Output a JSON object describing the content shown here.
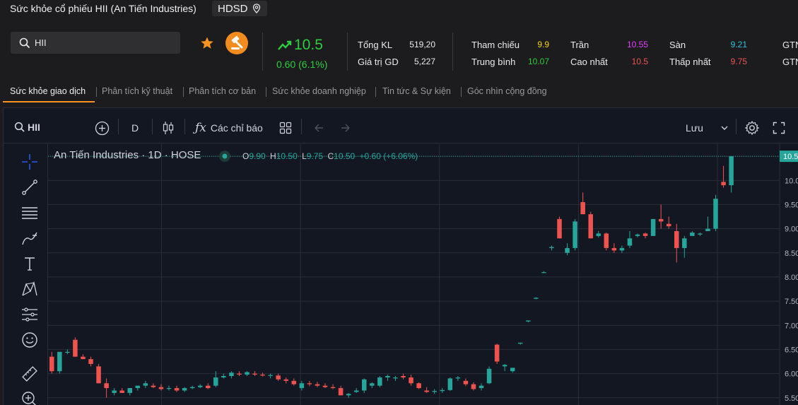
{
  "header": {
    "title": "Sức khỏe cổ phiếu HII (An Tiến Industries)",
    "hdsd_label": "HDSD"
  },
  "search": {
    "value": "HII"
  },
  "quote": {
    "price": "10.5",
    "change": "0.60 (6.1%)",
    "up_color": "#2ecc40"
  },
  "stats": [
    {
      "label": "Tổng KL",
      "value": "519,20",
      "color": "#eaeaea"
    },
    {
      "label": "Giá trị GD",
      "value": "5,227",
      "color": "#eaeaea"
    },
    {
      "label": "Tham chiếu",
      "value": "9.9",
      "color": "#f5d300"
    },
    {
      "label": "Trung bình",
      "value": "10.07",
      "color": "#2ecc40"
    },
    {
      "label": "Trần",
      "value": "10.55",
      "color": "#e040fb"
    },
    {
      "label": "Cao nhất",
      "value": "10.5",
      "color": "#ef5350"
    },
    {
      "label": "Sàn",
      "value": "9.21",
      "color": "#26c6da"
    },
    {
      "label": "Thấp nhất",
      "value": "9.75",
      "color": "#ef5350"
    },
    {
      "label": "GTN",
      "value": "",
      "color": "#eaeaea"
    },
    {
      "label": "GTN",
      "value": "",
      "color": "#eaeaea"
    }
  ],
  "tabs": [
    "Sức khỏe giao dịch",
    "Phân tích kỹ thuật",
    "Phân tích cơ bản",
    "Sức khỏe doanh nghiệp",
    "Tin tức & Sự kiện",
    "Góc nhìn cộng đồng"
  ],
  "chart_toolbar": {
    "symbol": "HII",
    "interval": "D",
    "indicators_label": "Các chỉ báo",
    "save_label": "Lưu"
  },
  "legend": {
    "name": "An Tiến Industries · 1D · HOSE",
    "o_label": "O",
    "o_value": "9.90",
    "h_label": "H",
    "h_value": "10.50",
    "l_label": "L",
    "l_value": "9.75",
    "c_label": "C",
    "c_value": "10.50",
    "change": "+0.60 (+6.06%)"
  },
  "colors": {
    "up": "#26a69a",
    "down": "#ef5350",
    "accent": "#f7931e",
    "chart_bg": "#131722"
  },
  "chart_data": {
    "type": "candlestick",
    "title": "",
    "y_ticks": [
      "10.50",
      "10.00",
      "9.50",
      "9.00",
      "8.50",
      "8.00",
      "7.50",
      "7.00",
      "6.50",
      "6.00",
      "5.50"
    ],
    "ylim": [
      5.35,
      10.75
    ],
    "last_price_label": "10.50",
    "candles": [
      {
        "o": 6.35,
        "h": 6.45,
        "l": 6.0,
        "c": 6.05
      },
      {
        "o": 6.05,
        "h": 6.45,
        "l": 6.0,
        "c": 6.45
      },
      {
        "o": 6.45,
        "h": 6.5,
        "l": 6.4,
        "c": 6.45
      },
      {
        "o": 6.7,
        "h": 6.75,
        "l": 6.35,
        "c": 6.35
      },
      {
        "o": 6.35,
        "h": 6.4,
        "l": 6.3,
        "c": 6.3
      },
      {
        "o": 6.3,
        "h": 6.35,
        "l": 6.15,
        "c": 6.2
      },
      {
        "o": 6.15,
        "h": 6.2,
        "l": 5.8,
        "c": 5.8
      },
      {
        "o": 5.8,
        "h": 5.9,
        "l": 5.5,
        "c": 5.7
      },
      {
        "o": 5.6,
        "h": 5.7,
        "l": 5.55,
        "c": 5.65
      },
      {
        "o": 5.65,
        "h": 5.7,
        "l": 5.6,
        "c": 5.6
      },
      {
        "o": 5.6,
        "h": 5.7,
        "l": 5.55,
        "c": 5.7
      },
      {
        "o": 5.7,
        "h": 5.75,
        "l": 5.65,
        "c": 5.75
      },
      {
        "o": 5.75,
        "h": 5.85,
        "l": 5.7,
        "c": 5.8
      },
      {
        "o": 5.75,
        "h": 5.8,
        "l": 5.7,
        "c": 5.72
      },
      {
        "o": 5.72,
        "h": 5.78,
        "l": 5.65,
        "c": 5.68
      },
      {
        "o": 5.7,
        "h": 5.75,
        "l": 5.65,
        "c": 5.7
      },
      {
        "o": 5.7,
        "h": 5.75,
        "l": 5.62,
        "c": 5.65
      },
      {
        "o": 5.65,
        "h": 5.72,
        "l": 5.62,
        "c": 5.7
      },
      {
        "o": 5.7,
        "h": 5.75,
        "l": 5.68,
        "c": 5.72
      },
      {
        "o": 5.72,
        "h": 5.78,
        "l": 5.7,
        "c": 5.75
      },
      {
        "o": 5.75,
        "h": 5.8,
        "l": 5.68,
        "c": 5.7
      },
      {
        "o": 5.75,
        "h": 6.05,
        "l": 5.72,
        "c": 5.92
      },
      {
        "o": 5.92,
        "h": 6.0,
        "l": 5.9,
        "c": 5.95
      },
      {
        "o": 5.95,
        "h": 6.05,
        "l": 5.9,
        "c": 6.02
      },
      {
        "o": 6.0,
        "h": 6.05,
        "l": 5.95,
        "c": 5.98
      },
      {
        "o": 5.98,
        "h": 6.05,
        "l": 5.95,
        "c": 6.03
      },
      {
        "o": 6.0,
        "h": 6.05,
        "l": 5.95,
        "c": 5.98
      },
      {
        "o": 5.98,
        "h": 6.02,
        "l": 5.94,
        "c": 5.96
      },
      {
        "o": 5.96,
        "h": 6.0,
        "l": 5.9,
        "c": 5.97
      },
      {
        "o": 5.96,
        "h": 6.0,
        "l": 5.85,
        "c": 5.88
      },
      {
        "o": 5.88,
        "h": 5.92,
        "l": 5.8,
        "c": 5.85
      },
      {
        "o": 5.85,
        "h": 5.9,
        "l": 5.75,
        "c": 5.78
      },
      {
        "o": 5.7,
        "h": 5.85,
        "l": 5.65,
        "c": 5.8
      },
      {
        "o": 5.8,
        "h": 5.85,
        "l": 5.74,
        "c": 5.78
      },
      {
        "o": 5.78,
        "h": 5.83,
        "l": 5.72,
        "c": 5.75
      },
      {
        "o": 5.75,
        "h": 5.8,
        "l": 5.7,
        "c": 5.72
      },
      {
        "o": 5.72,
        "h": 5.78,
        "l": 5.68,
        "c": 5.7
      },
      {
        "o": 5.7,
        "h": 5.75,
        "l": 5.55,
        "c": 5.55
      },
      {
        "o": 5.55,
        "h": 5.6,
        "l": 5.5,
        "c": 5.58
      },
      {
        "o": 5.62,
        "h": 5.7,
        "l": 5.6,
        "c": 5.65
      },
      {
        "o": 5.65,
        "h": 5.9,
        "l": 5.6,
        "c": 5.88
      },
      {
        "o": 5.75,
        "h": 5.82,
        "l": 5.7,
        "c": 5.8
      },
      {
        "o": 5.75,
        "h": 5.95,
        "l": 5.72,
        "c": 5.92
      },
      {
        "o": 5.92,
        "h": 5.98,
        "l": 5.85,
        "c": 5.95
      },
      {
        "o": 5.9,
        "h": 5.95,
        "l": 5.85,
        "c": 5.92
      },
      {
        "o": 5.95,
        "h": 6.0,
        "l": 5.88,
        "c": 5.92
      },
      {
        "o": 5.92,
        "h": 5.98,
        "l": 5.75,
        "c": 5.8
      },
      {
        "o": 5.8,
        "h": 5.82,
        "l": 5.68,
        "c": 5.7
      },
      {
        "o": 5.65,
        "h": 5.72,
        "l": 5.6,
        "c": 5.62
      },
      {
        "o": 5.62,
        "h": 5.68,
        "l": 5.58,
        "c": 5.64
      },
      {
        "o": 5.64,
        "h": 5.7,
        "l": 5.6,
        "c": 5.66
      },
      {
        "o": 5.66,
        "h": 5.92,
        "l": 5.64,
        "c": 5.9
      },
      {
        "o": 5.9,
        "h": 5.95,
        "l": 5.85,
        "c": 5.92
      },
      {
        "o": 5.85,
        "h": 5.9,
        "l": 5.74,
        "c": 5.78
      },
      {
        "o": 5.78,
        "h": 5.82,
        "l": 5.65,
        "c": 5.68
      },
      {
        "o": 5.7,
        "h": 5.8,
        "l": 5.65,
        "c": 5.75
      },
      {
        "o": 5.8,
        "h": 6.15,
        "l": 5.78,
        "c": 6.1
      },
      {
        "o": 6.6,
        "h": 6.62,
        "l": 6.2,
        "c": 6.25
      },
      {
        "o": 6.15,
        "h": 6.2,
        "l": 6.05,
        "c": 6.18
      },
      {
        "o": 6.05,
        "h": 6.12,
        "l": 6.02,
        "c": 6.12
      },
      {
        "o": 6.62,
        "h": 6.64,
        "l": 6.6,
        "c": 6.64
      },
      {
        "o": 7.08,
        "h": 7.1,
        "l": 7.06,
        "c": 7.1
      },
      {
        "o": 7.55,
        "h": 7.58,
        "l": 7.54,
        "c": 7.57
      },
      {
        "o": 8.1,
        "h": 8.12,
        "l": 8.08,
        "c": 8.1
      },
      {
        "o": 8.6,
        "h": 8.65,
        "l": 8.55,
        "c": 8.62
      },
      {
        "o": 9.2,
        "h": 9.25,
        "l": 8.8,
        "c": 8.8
      },
      {
        "o": 8.5,
        "h": 8.7,
        "l": 8.45,
        "c": 8.6
      },
      {
        "o": 8.6,
        "h": 9.2,
        "l": 8.55,
        "c": 9.15
      },
      {
        "o": 9.55,
        "h": 9.75,
        "l": 9.3,
        "c": 9.3
      },
      {
        "o": 9.3,
        "h": 9.35,
        "l": 8.8,
        "c": 8.8
      },
      {
        "o": 8.85,
        "h": 8.95,
        "l": 8.82,
        "c": 8.9
      },
      {
        "o": 8.9,
        "h": 8.92,
        "l": 8.55,
        "c": 8.6
      },
      {
        "o": 8.6,
        "h": 8.7,
        "l": 8.5,
        "c": 8.55
      },
      {
        "o": 8.55,
        "h": 8.65,
        "l": 8.5,
        "c": 8.6
      },
      {
        "o": 8.65,
        "h": 8.95,
        "l": 8.6,
        "c": 8.8
      },
      {
        "o": 8.85,
        "h": 8.9,
        "l": 8.82,
        "c": 8.88
      },
      {
        "o": 8.9,
        "h": 8.92,
        "l": 8.8,
        "c": 8.85
      },
      {
        "o": 8.85,
        "h": 9.2,
        "l": 8.85,
        "c": 9.2
      },
      {
        "o": 9.2,
        "h": 9.5,
        "l": 9.0,
        "c": 9.15
      },
      {
        "o": 9.1,
        "h": 9.25,
        "l": 9.0,
        "c": 9.05
      },
      {
        "o": 8.95,
        "h": 9.1,
        "l": 8.3,
        "c": 8.6
      },
      {
        "o": 8.6,
        "h": 8.85,
        "l": 8.4,
        "c": 8.8
      },
      {
        "o": 8.85,
        "h": 8.95,
        "l": 8.85,
        "c": 8.92
      },
      {
        "o": 8.88,
        "h": 8.92,
        "l": 8.85,
        "c": 8.9
      },
      {
        "o": 8.95,
        "h": 9.25,
        "l": 8.95,
        "c": 9.0
      },
      {
        "o": 9.0,
        "h": 9.7,
        "l": 8.95,
        "c": 9.62
      },
      {
        "o": 9.97,
        "h": 10.3,
        "l": 9.85,
        "c": 9.9
      },
      {
        "o": 9.9,
        "h": 10.5,
        "l": 9.75,
        "c": 10.5
      }
    ]
  }
}
